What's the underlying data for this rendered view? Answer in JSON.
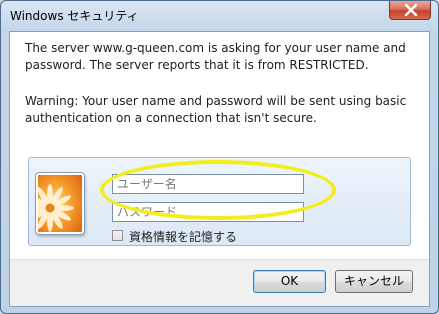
{
  "window": {
    "title": "Windows セキュリティ"
  },
  "message": {
    "line1": "The server www.g-queen.com is asking for your user name and password. The server reports that it is from RESTRICTED.",
    "warning": "Warning: Your user name and password will be sent using basic authentication on a connection that isn't secure."
  },
  "credentials": {
    "username_placeholder": "ユーザー名",
    "password_placeholder": "パスワード",
    "remember_label": "資格情報を記憶する",
    "remember_checked": false
  },
  "buttons": {
    "ok": "OK",
    "cancel": "キャンセル"
  },
  "annotation": {
    "highlight_color": "#f2ee1b"
  }
}
